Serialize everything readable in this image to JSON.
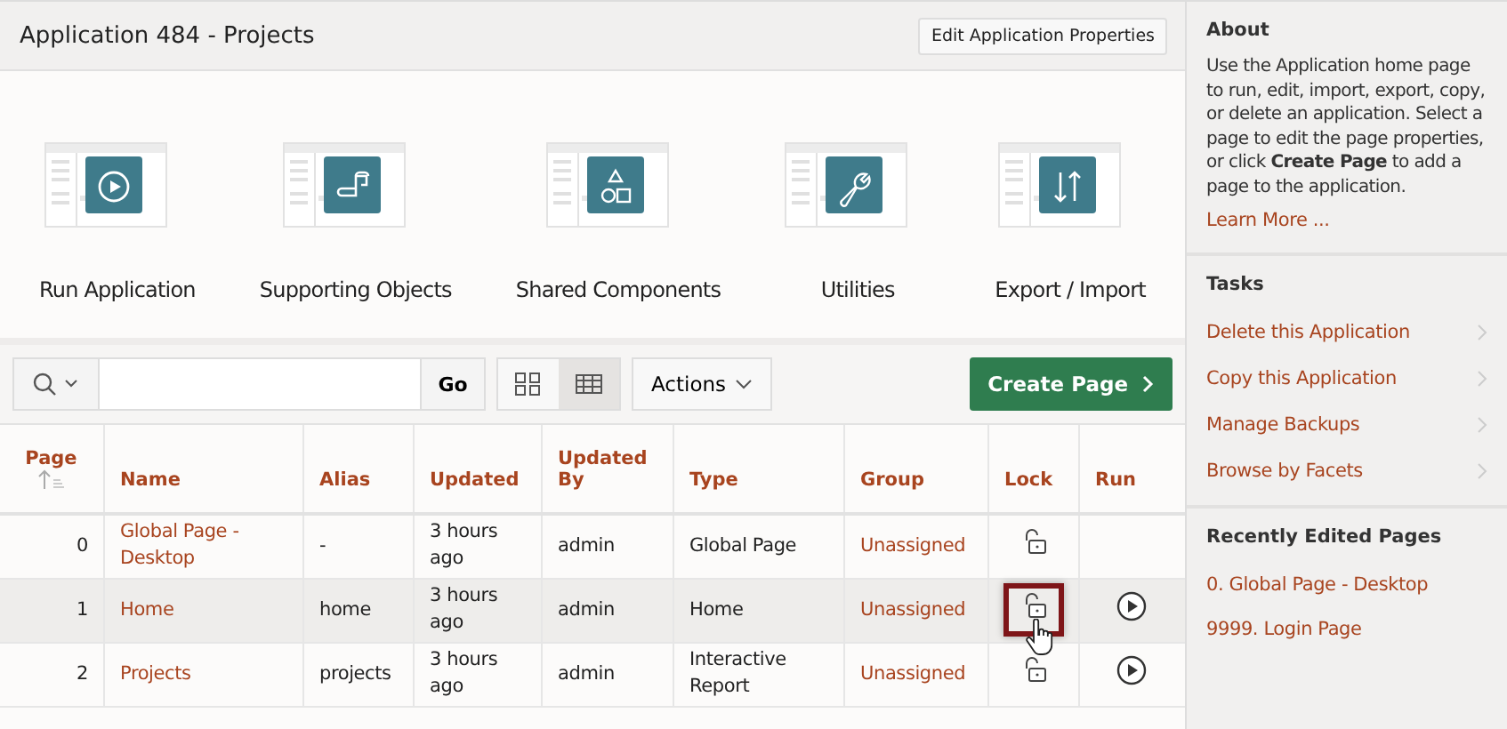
{
  "header": {
    "title": "Application 484 - Projects",
    "edit_button": "Edit Application Properties"
  },
  "tiles": [
    {
      "label": "Run Application",
      "kind": "run"
    },
    {
      "label": "Supporting Objects",
      "kind": "scroll"
    },
    {
      "label": "Shared Components",
      "kind": "shapes"
    },
    {
      "label": "Utilities",
      "kind": "wrench"
    },
    {
      "label": "Export / Import",
      "kind": "arrows"
    }
  ],
  "toolbar": {
    "go": "Go",
    "views": [
      {
        "kind": "icons",
        "selected": false
      },
      {
        "kind": "report",
        "selected": true
      }
    ],
    "actions": "Actions",
    "create": "Create Page"
  },
  "table": {
    "columns": [
      {
        "label": "Page",
        "sorted": true
      },
      {
        "label": "Name",
        "sorted": false
      },
      {
        "label": "Alias",
        "sorted": false
      },
      {
        "label": "Updated",
        "sorted": false
      },
      {
        "label": "Updated By",
        "sorted": false
      },
      {
        "label": "Type",
        "sorted": false
      },
      {
        "label": "Group",
        "sorted": false
      },
      {
        "label": "Lock",
        "sorted": false
      },
      {
        "label": "Run",
        "sorted": false
      }
    ],
    "rows": [
      {
        "page": "0",
        "name": "Global Page - Desktop",
        "alias": "-",
        "updated": "3 hours ago",
        "updated_by": "admin",
        "type": "Global Page",
        "group": "Unassigned",
        "hovered": false,
        "lock_highlighted": false,
        "run": false
      },
      {
        "page": "1",
        "name": "Home",
        "alias": "home",
        "updated": "3 hours ago",
        "updated_by": "admin",
        "type": "Home",
        "group": "Unassigned",
        "hovered": true,
        "lock_highlighted": true,
        "run": true
      },
      {
        "page": "2",
        "name": "Projects",
        "alias": "projects",
        "updated": "3 hours ago",
        "updated_by": "admin",
        "type": "Interactive Report",
        "group": "Unassigned",
        "hovered": false,
        "lock_highlighted": false,
        "run": true
      }
    ]
  },
  "sidebar": {
    "about": {
      "title": "About",
      "text": "Use the Application home page to run, edit, import, export, copy, or delete an application. Select a page to edit the page properties, or click **Create Page** to add a page to the application.",
      "link": "Learn More ..."
    },
    "tasks": {
      "title": "Tasks",
      "items": [
        "Delete this Application",
        "Copy this Application",
        "Manage Backups",
        "Browse by Facets"
      ]
    },
    "recent": {
      "title": "Recently Edited Pages",
      "items": [
        "0. Global Page - Desktop",
        "9999. Login Page"
      ]
    }
  }
}
